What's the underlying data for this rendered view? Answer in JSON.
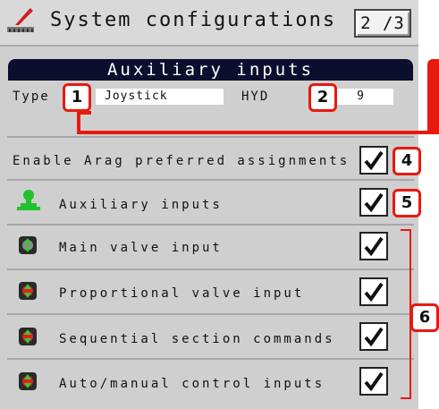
{
  "header": {
    "title": "System configurations",
    "page": "2 /3",
    "icon": "system-config-icon"
  },
  "aux_section": {
    "title": "Auxiliary inputs",
    "type_label": "Type",
    "type_value": "Joystick",
    "hyd_label": "HYD",
    "hyd_value": "9"
  },
  "rows": [
    {
      "label": "Enable Arag preferred assignments",
      "checked": true
    },
    {
      "label": "Auxiliary inputs",
      "checked": true,
      "icon": "green-person-icon"
    },
    {
      "label": "Main valve input",
      "checked": true,
      "icon": "main-valve-icon"
    },
    {
      "label": "Proportional valve input",
      "checked": true,
      "icon": "proportional-valve-icon"
    },
    {
      "label": "Sequential section commands",
      "checked": true,
      "icon": "sequential-section-icon"
    },
    {
      "label": "Auto/manual control inputs",
      "checked": true,
      "icon": "auto-manual-icon"
    }
  ],
  "callouts": [
    "1",
    "2",
    "4",
    "5",
    "6"
  ],
  "colors": {
    "callout": "#e8190f",
    "header_bg": "#0b0e2c",
    "accent_green": "#22c22e"
  }
}
